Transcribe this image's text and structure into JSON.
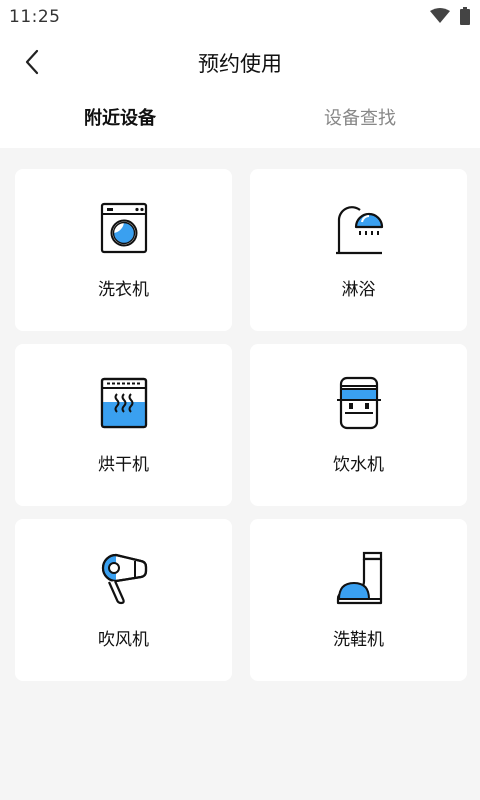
{
  "status": {
    "time": "11:25"
  },
  "header": {
    "title": "预约使用"
  },
  "tabs": [
    {
      "label": "附近设备",
      "active": true
    },
    {
      "label": "设备查找",
      "active": false
    }
  ],
  "devices": [
    {
      "label": "洗衣机",
      "icon": "washing-machine-icon"
    },
    {
      "label": "淋浴",
      "icon": "shower-icon"
    },
    {
      "label": "烘干机",
      "icon": "dryer-icon"
    },
    {
      "label": "饮水机",
      "icon": "water-dispenser-icon"
    },
    {
      "label": "吹风机",
      "icon": "hair-dryer-icon"
    },
    {
      "label": "洗鞋机",
      "icon": "shoe-washer-icon"
    }
  ],
  "colors": {
    "accent": "#3aa0f0",
    "stroke": "#111111",
    "background": "#f5f5f5"
  }
}
